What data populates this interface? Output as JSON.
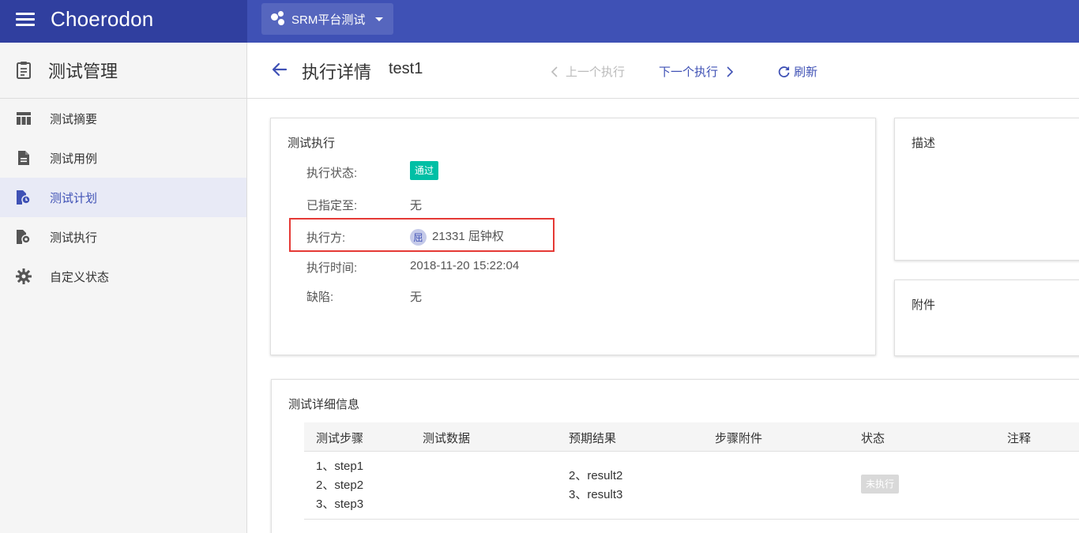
{
  "app": {
    "brand": "Choerodon",
    "project": "SRM平台测试"
  },
  "sidebar": {
    "title": "测试管理",
    "items": [
      {
        "label": "测试摘要",
        "icon": "table-icon",
        "active": false
      },
      {
        "label": "测试用例",
        "icon": "document-icon",
        "active": false
      },
      {
        "label": "测试计划",
        "icon": "file-clock-icon",
        "active": true
      },
      {
        "label": "测试执行",
        "icon": "file-settings-icon",
        "active": false
      },
      {
        "label": "自定义状态",
        "icon": "gear-icon",
        "active": false
      }
    ]
  },
  "header": {
    "title": "执行详情",
    "subtitle": "test1",
    "prev_label": "上一个执行",
    "next_label": "下一个执行",
    "refresh_label": "刷新"
  },
  "execution": {
    "card_title": "测试执行",
    "status_label": "执行状态:",
    "status_value": "通过",
    "status_color": "#00bfa5",
    "assigned_label": "已指定至:",
    "assigned_value": "无",
    "executor_label": "执行方:",
    "executor_avatar": "屈",
    "executor_value": "21331 屈钟权",
    "time_label": "执行时间:",
    "time_value": "2018-11-20 15:22:04",
    "defect_label": "缺陷:",
    "defect_value": "无"
  },
  "description": {
    "title": "描述"
  },
  "attachments": {
    "title": "附件"
  },
  "details": {
    "title": "测试详细信息",
    "columns": [
      "测试步骤",
      "测试数据",
      "预期结果",
      "步骤附件",
      "状态",
      "注释"
    ],
    "rows": [
      {
        "steps": [
          "1、step1",
          "2、step2",
          "3、step3"
        ],
        "data": "",
        "expected": [
          "2、result2",
          "3、result3"
        ],
        "attachment": "",
        "status": "未执行",
        "comment": ""
      }
    ]
  },
  "colors": {
    "primary": "#3f51b5",
    "header_dark": "#303f9f",
    "pass": "#00bfa5",
    "not_run": "#d9d9d9",
    "highlight": "#e53935"
  }
}
